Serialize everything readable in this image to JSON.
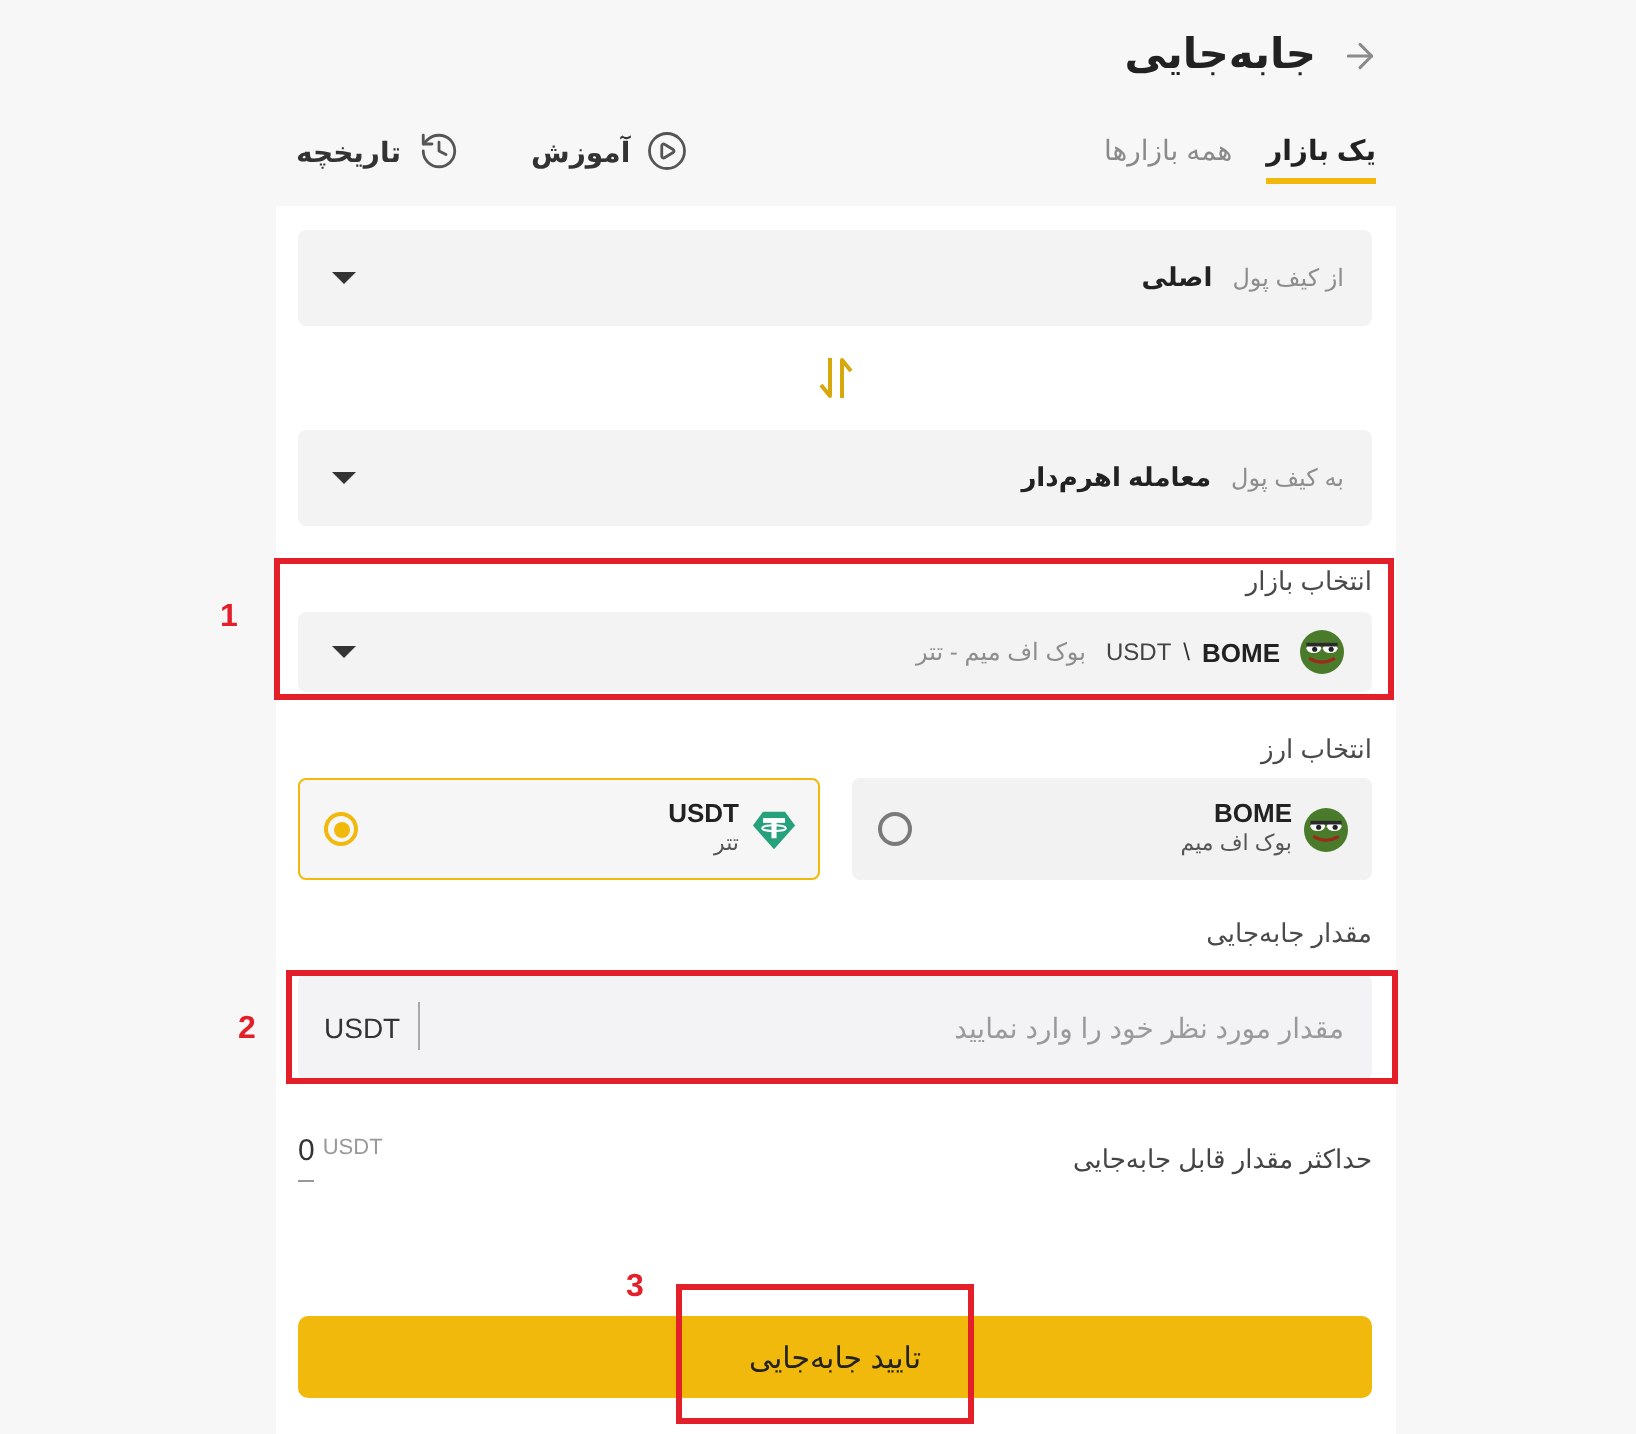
{
  "header": {
    "title": "جابه‌جایی"
  },
  "tabs": [
    {
      "label": "یک بازار",
      "selected": true
    },
    {
      "label": "همه بازارها",
      "selected": false
    }
  ],
  "links": [
    {
      "label": "آموزش",
      "kind": "tutorial"
    },
    {
      "label": "تاریخچه",
      "kind": "history"
    }
  ],
  "from_wallet": {
    "label": "از کیف پول",
    "value": "اصلی"
  },
  "to_wallet": {
    "label": "به کیف پول",
    "value": "معامله اهرم‌دار"
  },
  "market": {
    "label": "انتخاب بازار",
    "base": "BOME",
    "separator": "\\",
    "quote": "USDT",
    "name": "بوک اف میم - تتر",
    "annotation": "1"
  },
  "currency": {
    "label": "انتخاب ارز",
    "options": [
      {
        "kind": "bome",
        "symbol": "BOME",
        "name": "بوک اف میم",
        "selected": false
      },
      {
        "kind": "usdt",
        "symbol": "USDT",
        "name": "تتر",
        "selected": true
      }
    ]
  },
  "amount": {
    "label": "مقدار جابه‌جایی",
    "placeholder": "مقدار مورد نظر خود را وارد نمایید",
    "unit": "USDT",
    "annotation": "2"
  },
  "max": {
    "label": "حداکثر مقدار قابل جابه‌جایی",
    "value": "0",
    "unit": "USDT"
  },
  "confirm": {
    "label": "تایید جابه‌جایی",
    "annotation": "3"
  }
}
